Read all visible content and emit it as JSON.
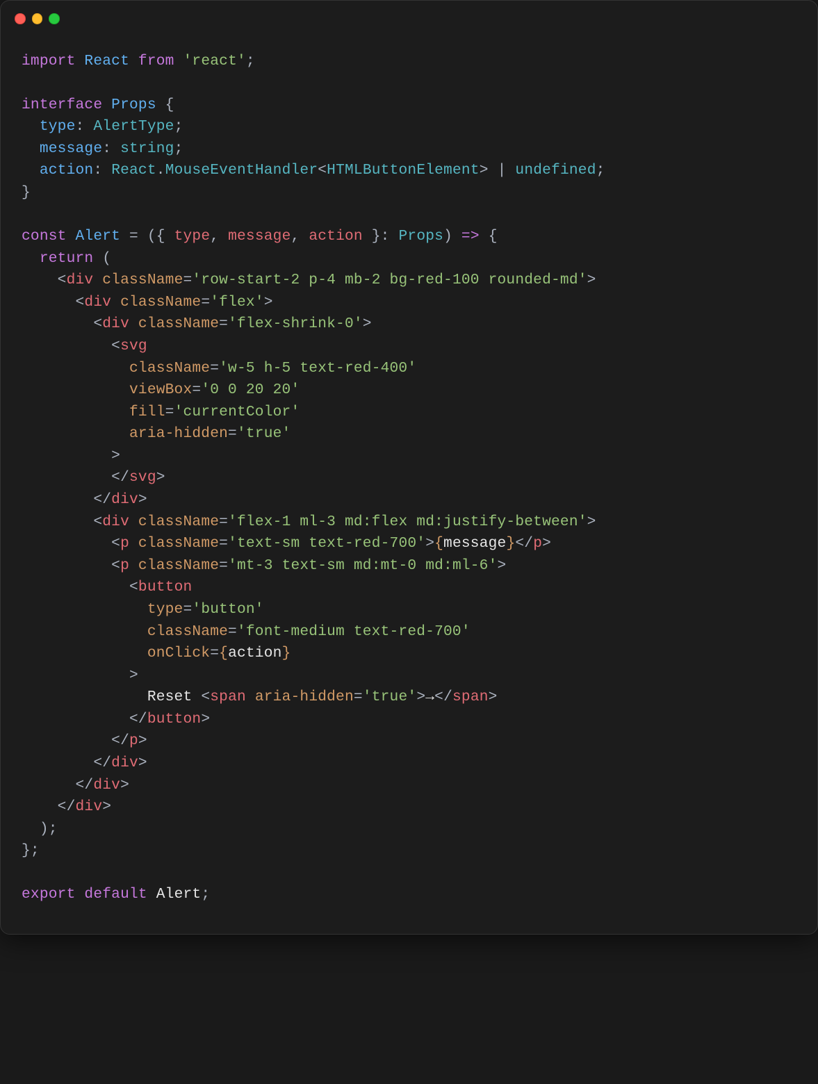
{
  "line01": {
    "kw1": "import",
    "react": "React",
    "kw2": "from",
    "str": "'react'",
    "end": ";"
  },
  "line03": {
    "kw": "interface",
    "name": "Props",
    "brace": " {"
  },
  "line04": {
    "key": "type",
    "sep": ": ",
    "type": "AlertType",
    "end": ";"
  },
  "line05": {
    "key": "message",
    "sep": ": ",
    "type": "string",
    "end": ";"
  },
  "line06": {
    "key": "action",
    "sep": ": ",
    "t1": "React",
    "dot": ".",
    "t2": "MouseEventHandler",
    "lt": "<",
    "t3": "HTMLButtonElement",
    "gt": "> | ",
    "t4": "undefined",
    "end": ";"
  },
  "line07": {
    "brace": "}"
  },
  "line09": {
    "kw": "const",
    "name": "Alert",
    "eq": " = ({ ",
    "v1": "type",
    "c1": ", ",
    "v2": "message",
    "c2": ", ",
    "v3": "action",
    "close": " }: ",
    "props": "Props",
    "paren": ")",
    "arrow": " => ",
    "brace": "{"
  },
  "line10": {
    "kw": "return",
    "paren": " ("
  },
  "line11": {
    "open": "<",
    "tag": "div",
    "attr": "className",
    "eq": "=",
    "str": "'row-start-2 p-4 mb-2 bg-red-100 rounded-md'",
    "close": ">"
  },
  "line12": {
    "open": "<",
    "tag": "div",
    "attr": "className",
    "eq": "=",
    "str": "'flex'",
    "close": ">"
  },
  "line13": {
    "open": "<",
    "tag": "div",
    "attr": "className",
    "eq": "=",
    "str": "'flex-shrink-0'",
    "close": ">"
  },
  "line14": {
    "open": "<",
    "tag": "svg"
  },
  "line15": {
    "attr": "className",
    "eq": "=",
    "str": "'w-5 h-5 text-red-400'"
  },
  "line16": {
    "attr": "viewBox",
    "eq": "=",
    "str": "'0 0 20 20'"
  },
  "line17": {
    "attr": "fill",
    "eq": "=",
    "str": "'currentColor'"
  },
  "line18": {
    "attr": "aria-hidden",
    "eq": "=",
    "str": "'true'"
  },
  "line19": {
    "close": ">"
  },
  "line20": {
    "open": "</",
    "tag": "svg",
    "close": ">"
  },
  "line21": {
    "open": "</",
    "tag": "div",
    "close": ">"
  },
  "line22": {
    "open": "<",
    "tag": "div",
    "attr": "className",
    "eq": "=",
    "str": "'flex-1 ml-3 md:flex md:justify-between'",
    "close": ">"
  },
  "line23": {
    "open": "<",
    "tag": "p",
    "attr": "className",
    "eq": "=",
    "str": "'text-sm text-red-700'",
    "close": ">",
    "bro": "{",
    "var": "message",
    "brc": "}",
    "open2": "</",
    "tag2": "p",
    "close2": ">"
  },
  "line24": {
    "open": "<",
    "tag": "p",
    "attr": "className",
    "eq": "=",
    "str": "'mt-3 text-sm md:mt-0 md:ml-6'",
    "close": ">"
  },
  "line25": {
    "open": "<",
    "tag": "button"
  },
  "line26": {
    "attr": "type",
    "eq": "=",
    "str": "'button'"
  },
  "line27": {
    "attr": "className",
    "eq": "=",
    "str": "'font-medium text-red-700'"
  },
  "line28": {
    "attr": "onClick",
    "eq": "=",
    "bro": "{",
    "var": "action",
    "brc": "}"
  },
  "line29": {
    "close": ">"
  },
  "line30": {
    "text": "Reset ",
    "open": "<",
    "tag": "span",
    "attr": "aria-hidden",
    "eq": "=",
    "str": "'true'",
    "close": ">",
    "arrow": "→",
    "open2": "</",
    "tag2": "span",
    "close2": ">"
  },
  "line31": {
    "open": "</",
    "tag": "button",
    "close": ">"
  },
  "line32": {
    "open": "</",
    "tag": "p",
    "close": ">"
  },
  "line33": {
    "open": "</",
    "tag": "div",
    "close": ">"
  },
  "line34": {
    "open": "</",
    "tag": "div",
    "close": ">"
  },
  "line35": {
    "open": "</",
    "tag": "div",
    "close": ">"
  },
  "line36": {
    "paren": ");"
  },
  "line37": {
    "brace": "};"
  },
  "line39": {
    "kw1": "export",
    "kw2": "default",
    "name": "Alert",
    "end": ";"
  }
}
